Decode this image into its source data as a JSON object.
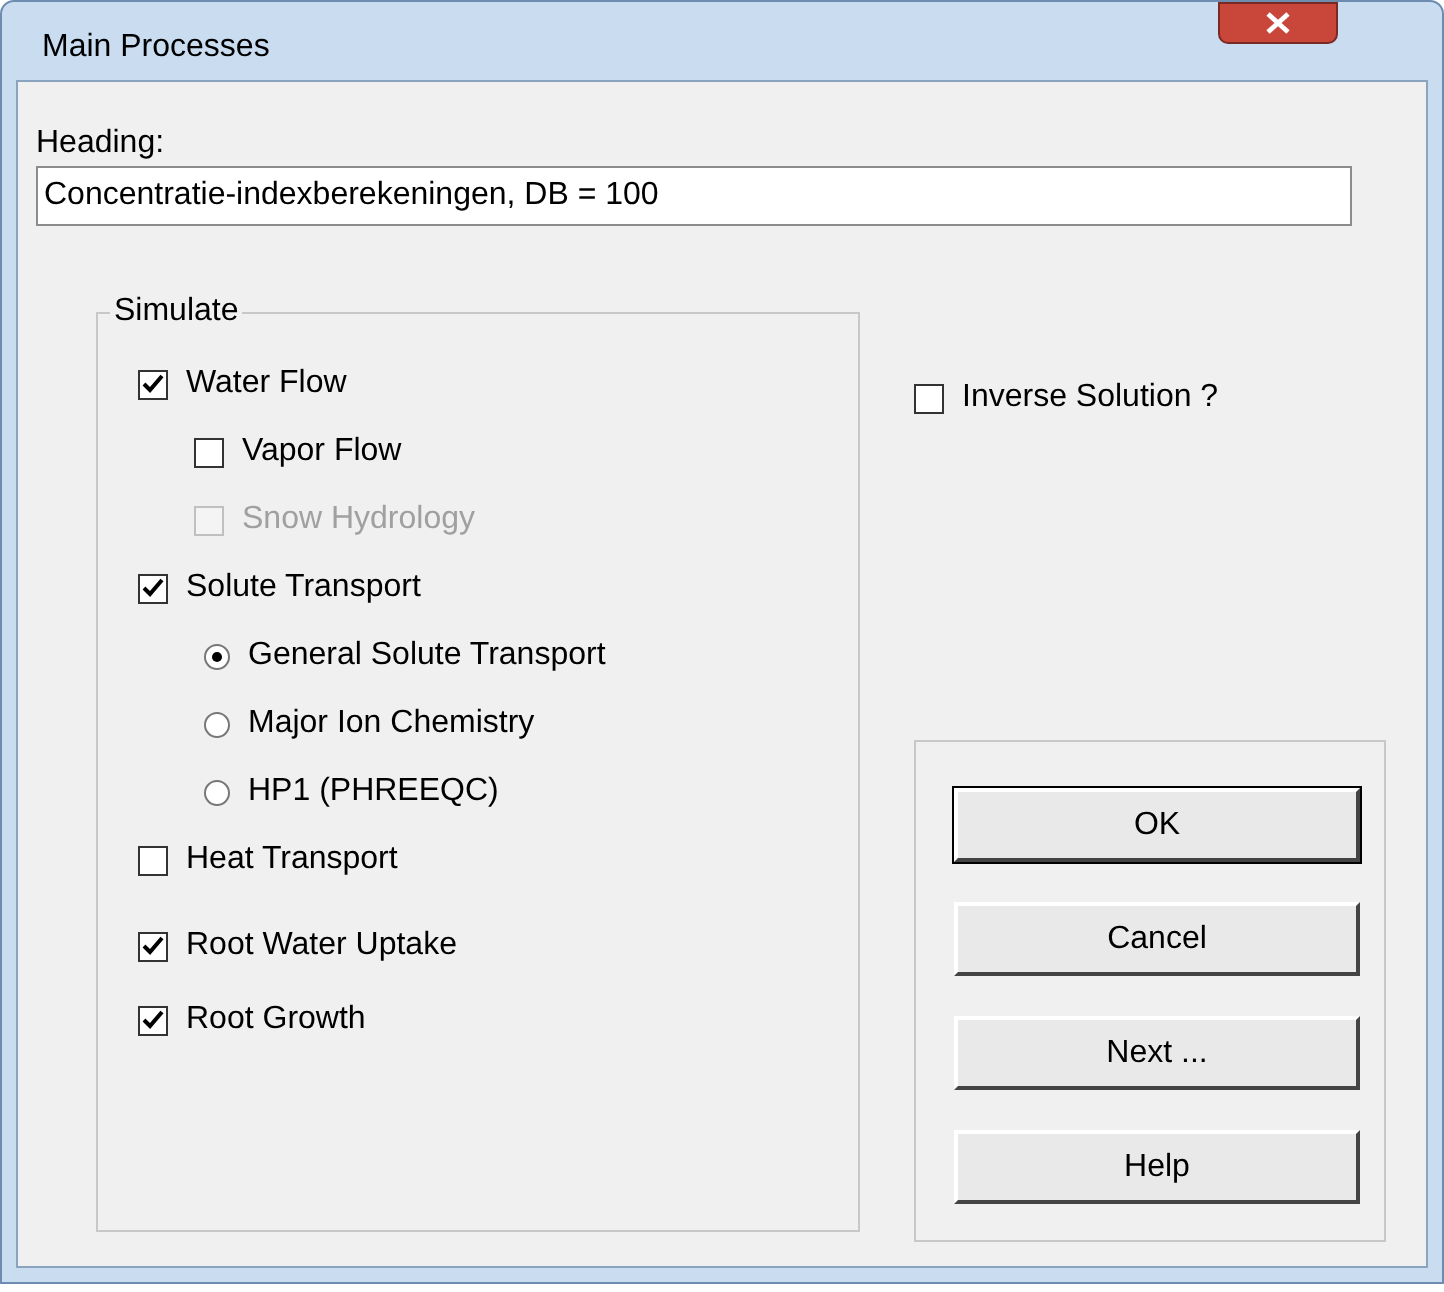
{
  "window": {
    "title": "Main Processes"
  },
  "heading": {
    "label": "Heading:",
    "value": "Concentratie-indexberekeningen, DB = 100"
  },
  "simulate": {
    "label": "Simulate",
    "items": [
      {
        "kind": "checkbox",
        "label": "Water Flow",
        "checked": true,
        "disabled": false,
        "children": [
          {
            "kind": "checkbox",
            "label": "Vapor Flow",
            "checked": false,
            "disabled": false
          },
          {
            "kind": "checkbox",
            "label": "Snow Hydrology",
            "checked": false,
            "disabled": true
          }
        ]
      },
      {
        "kind": "checkbox",
        "label": "Solute Transport",
        "checked": true,
        "disabled": false,
        "children": [
          {
            "kind": "radio",
            "label": "General Solute Transport",
            "selected": true
          },
          {
            "kind": "radio",
            "label": "Major Ion Chemistry",
            "selected": false
          },
          {
            "kind": "radio",
            "label": "HP1 (PHREEQC)",
            "selected": false
          }
        ]
      },
      {
        "kind": "checkbox",
        "label": "Heat Transport",
        "checked": false,
        "disabled": false
      },
      {
        "kind": "checkbox",
        "label": "Root Water Uptake",
        "checked": true,
        "disabled": false
      },
      {
        "kind": "checkbox",
        "label": "Root Growth",
        "checked": true,
        "disabled": false
      }
    ]
  },
  "inverse_solution": {
    "label": "Inverse Solution ?",
    "checked": false
  },
  "buttons": [
    {
      "label": "OK"
    },
    {
      "label": "Cancel"
    },
    {
      "label": "Next ..."
    },
    {
      "label": "Help"
    }
  ]
}
